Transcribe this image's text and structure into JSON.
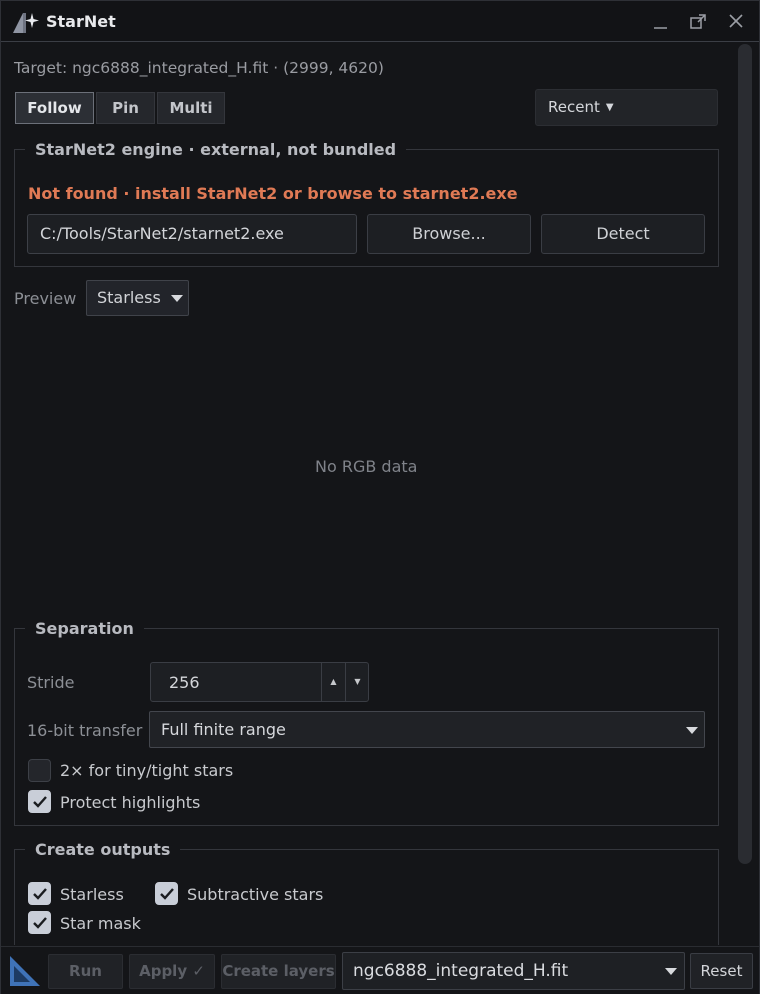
{
  "window": {
    "title": "StarNet"
  },
  "target": {
    "text": "Target: ngc6888_integrated_H.fit · (2999, 4620)"
  },
  "modes": {
    "follow": "Follow",
    "pin": "Pin",
    "multi": "Multi"
  },
  "recent": {
    "label": "Recent"
  },
  "engine": {
    "title": "StarNet2 engine · external, not bundled",
    "status": "Not found · install StarNet2 or browse to starnet2.exe",
    "path": "C:/Tools/StarNet2/starnet2.exe",
    "browse_label": "Browse...",
    "detect_label": "Detect"
  },
  "preview": {
    "label": "Preview",
    "selected": "Starless",
    "empty_text": "No RGB data"
  },
  "separation": {
    "title": "Separation",
    "stride_label": "Stride",
    "stride_value": "256",
    "transfer_label": "16-bit transfer",
    "transfer_value": "Full finite range",
    "tiny_stars_label": "2× for tiny/tight stars",
    "tiny_stars_checked": false,
    "protect_label": "Protect highlights",
    "protect_checked": true
  },
  "outputs": {
    "title": "Create outputs",
    "starless_label": "Starless",
    "subtractive_label": "Subtractive stars",
    "starmask_label": "Star mask"
  },
  "bottom": {
    "run_label": "Run",
    "apply_label": "Apply ✓",
    "create_layers_label": "Create layers",
    "target_file": "ngc6888_integrated_H.fit",
    "reset_label": "Reset"
  },
  "colors": {
    "accent": "#5b8fd6",
    "warning": "#e07a55",
    "background": "#141518"
  }
}
